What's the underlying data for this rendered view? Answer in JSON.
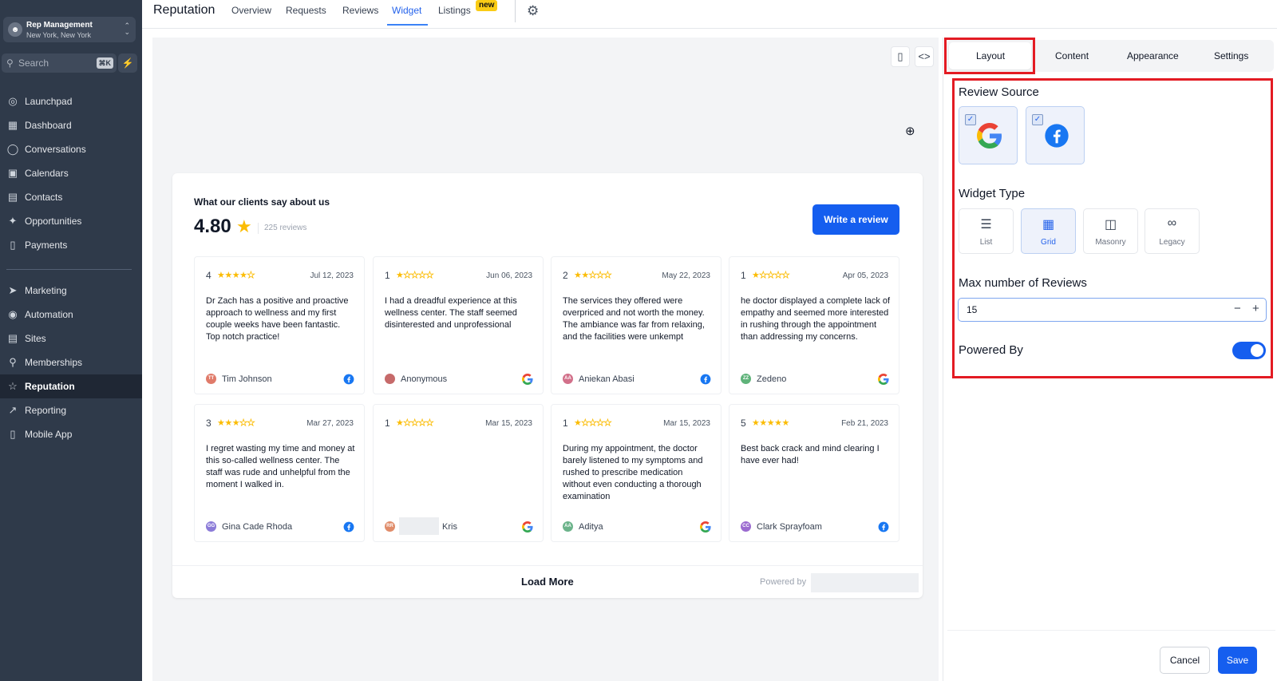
{
  "account": {
    "name": "Rep Management",
    "location": "New York, New York",
    "avatar_icon": "user-icon"
  },
  "search": {
    "placeholder": "Search",
    "shortcut": "⌘K"
  },
  "nav": {
    "items": [
      {
        "label": "Launchpad",
        "icon": "rocket-icon"
      },
      {
        "label": "Dashboard",
        "icon": "grid-icon"
      },
      {
        "label": "Conversations",
        "icon": "chat-icon"
      },
      {
        "label": "Calendars",
        "icon": "calendar-icon"
      },
      {
        "label": "Contacts",
        "icon": "contacts-icon"
      },
      {
        "label": "Opportunities",
        "icon": "funnel-icon"
      },
      {
        "label": "Payments",
        "icon": "receipt-icon"
      },
      {
        "label": "Marketing",
        "icon": "send-icon"
      },
      {
        "label": "Automation",
        "icon": "automation-icon"
      },
      {
        "label": "Sites",
        "icon": "site-icon"
      },
      {
        "label": "Memberships",
        "icon": "award-icon"
      },
      {
        "label": "Reputation",
        "icon": "star-icon",
        "active": true
      },
      {
        "label": "Reporting",
        "icon": "trend-icon"
      },
      {
        "label": "Mobile App",
        "icon": "phone-icon"
      }
    ]
  },
  "header": {
    "title": "Reputation",
    "tabs": [
      "Overview",
      "Requests",
      "Reviews",
      "Widget",
      "Listings"
    ],
    "active_tab": "Widget",
    "new_badge": "new"
  },
  "widget": {
    "heading": "What our clients say about us",
    "rating": "4.80",
    "review_count": "225 reviews",
    "write_button": "Write a review",
    "load_more": "Load More",
    "powered_by": "Powered by",
    "reviews": [
      {
        "rating": "4",
        "stars": 4,
        "date": "Jul 12, 2023",
        "text": "Dr Zach has a positive and proactive approach to wellness and my first couple weeks have been fantastic. Top notch practice!",
        "initials": "TT",
        "name": "Tim Johnson",
        "avatar_color": "#e07b6a",
        "source": "facebook"
      },
      {
        "rating": "1",
        "stars": 1,
        "date": "Jun 06, 2023",
        "text": "I had a dreadful experience at this wellness center. The staff seemed disinterested and unprofessional",
        "initials": "",
        "name": "Anonymous",
        "avatar_color": "#c66a6a",
        "source": "google"
      },
      {
        "rating": "2",
        "stars": 2,
        "date": "May 22, 2023",
        "text": "The services they offered were overpriced and not worth the money. The ambiance was far from relaxing, and the facilities were unkempt",
        "initials": "AA",
        "name": "Aniekan Abasi",
        "avatar_color": "#d2708a",
        "source": "facebook"
      },
      {
        "rating": "1",
        "stars": 1,
        "date": "Apr 05, 2023",
        "text": "he doctor displayed a complete lack of empathy and seemed more interested in rushing through the appointment than addressing my concerns.",
        "initials": "ZZ",
        "name": "Zedeno",
        "avatar_color": "#5fb37a",
        "source": "google"
      },
      {
        "rating": "3",
        "stars": 3,
        "date": "Mar 27, 2023",
        "text": "I regret wasting my time and money at this so-called wellness center. The staff was rude and unhelpful from the moment I walked in.",
        "initials": "GG",
        "name": "Gina Cade Rhoda",
        "avatar_color": "#8b7bd8",
        "source": "facebook"
      },
      {
        "rating": "1",
        "stars": 1,
        "date": "Mar 15, 2023",
        "text": "",
        "initials": "RR",
        "name": "Kris",
        "avatar_color": "#e08c6a",
        "source": "google",
        "redacted": true
      },
      {
        "rating": "1",
        "stars": 1,
        "date": "Mar 15, 2023",
        "text": "During my appointment, the doctor barely listened to my symptoms and rushed to prescribe medication without even conducting a thorough examination",
        "initials": "AA",
        "name": "Aditya",
        "avatar_color": "#6bb38a",
        "source": "google"
      },
      {
        "rating": "5",
        "stars": 5,
        "date": "Feb 21, 2023",
        "text": "Best back crack and mind clearing I have ever had!",
        "initials": "CC",
        "name": "Clark Sprayfoam",
        "avatar_color": "#9b6bd0",
        "source": "facebook"
      }
    ]
  },
  "panel": {
    "tabs": [
      "Layout",
      "Content",
      "Appearance",
      "Settings"
    ],
    "active_tab": "Layout",
    "review_source_label": "Review Source",
    "sources": [
      {
        "name": "google-icon",
        "checked": true
      },
      {
        "name": "facebook-icon",
        "checked": true
      }
    ],
    "widget_type_label": "Widget Type",
    "widget_types": [
      {
        "label": "List",
        "icon": "list-icon"
      },
      {
        "label": "Grid",
        "icon": "grid-icon",
        "active": true
      },
      {
        "label": "Masonry",
        "icon": "masonry-icon"
      },
      {
        "label": "Legacy",
        "icon": "infinity-icon"
      }
    ],
    "max_reviews_label": "Max number of Reviews",
    "max_reviews_value": "15",
    "powered_by_label": "Powered By",
    "powered_by_enabled": true,
    "cancel": "Cancel",
    "save": "Save"
  },
  "colors": {
    "accent": "#155eef",
    "highlight_box": "#e31b23",
    "star": "#fbbc04",
    "sidebar_bg": "#2f3a4a"
  }
}
